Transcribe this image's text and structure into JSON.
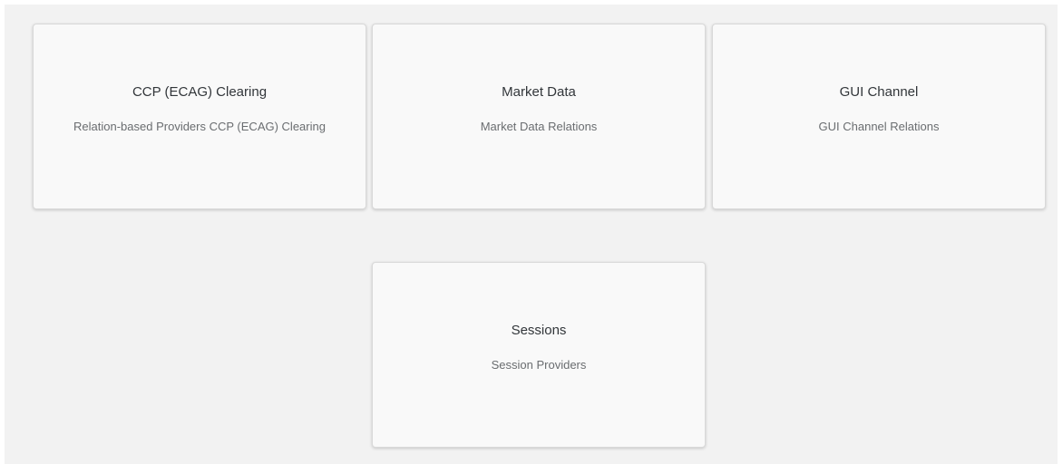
{
  "tiles": [
    {
      "title": "CCP (ECAG) Clearing",
      "subtitle": "Relation-based Providers CCP (ECAG) Clearing"
    },
    {
      "title": "Market Data",
      "subtitle": "Market Data Relations"
    },
    {
      "title": "GUI Channel",
      "subtitle": "GUI Channel Relations"
    },
    {
      "title": "Sessions",
      "subtitle": "Session Providers"
    }
  ],
  "colors": {
    "page_background": "#f2f2f2",
    "tile_background": "#f9f9f9",
    "title_text": "#32363a",
    "subtitle_text": "#6a6d70"
  }
}
